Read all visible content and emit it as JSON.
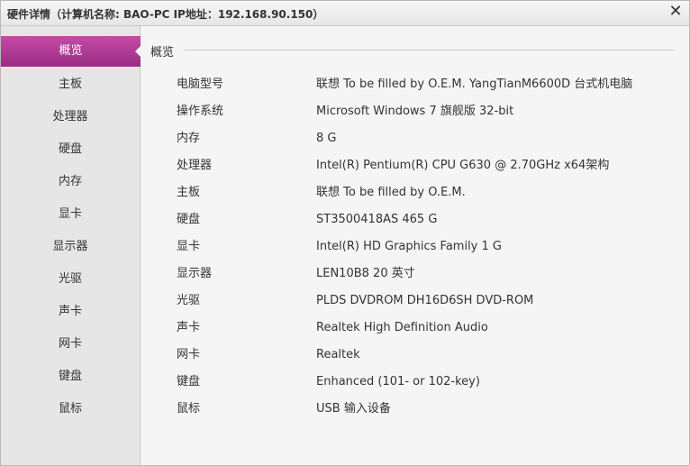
{
  "window": {
    "title": "硬件详情（计算机名称:   BAO-PC   IP地址：192.168.90.150）",
    "close_glyph": "✕"
  },
  "sidebar": {
    "items": [
      {
        "label": "概览"
      },
      {
        "label": "主板"
      },
      {
        "label": "处理器"
      },
      {
        "label": "硬盘"
      },
      {
        "label": "内存"
      },
      {
        "label": "显卡"
      },
      {
        "label": "显示器"
      },
      {
        "label": "光驱"
      },
      {
        "label": "声卡"
      },
      {
        "label": "网卡"
      },
      {
        "label": "键盘"
      },
      {
        "label": "鼠标"
      }
    ],
    "active": "概览"
  },
  "content": {
    "section_title": "概览",
    "rows": [
      {
        "label": "电脑型号",
        "value": "联想 To be filled by O.E.M. YangTianM6600D 台式机电脑"
      },
      {
        "label": "操作系统",
        "value": "Microsoft Windows 7 旗舰版 32-bit"
      },
      {
        "label": "内存",
        "value": "8 G"
      },
      {
        "label": "处理器",
        "value": "Intel(R) Pentium(R) CPU G630 @ 2.70GHz x64架构"
      },
      {
        "label": "主板",
        "value": "联想 To be filled by O.E.M."
      },
      {
        "label": "硬盘",
        "value": "ST3500418AS 465 G"
      },
      {
        "label": "显卡",
        "value": "Intel(R) HD Graphics Family 1 G"
      },
      {
        "label": "显示器",
        "value": "LEN10B8 20 英寸"
      },
      {
        "label": "光驱",
        "value": "PLDS DVDROM DH16D6SH DVD-ROM"
      },
      {
        "label": "声卡",
        "value": "Realtek High Definition Audio"
      },
      {
        "label": "网卡",
        "value": "Realtek"
      },
      {
        "label": "键盘",
        "value": "Enhanced (101- or 102-key)"
      },
      {
        "label": "鼠标",
        "value": "USB 输入设备"
      }
    ]
  },
  "colors": {
    "accent": "#b23a96",
    "sidebar_bg": "#e6e6e6",
    "content_bg": "#f5f5f5",
    "text": "#333333"
  },
  "icons": {
    "close": "close-icon"
  }
}
